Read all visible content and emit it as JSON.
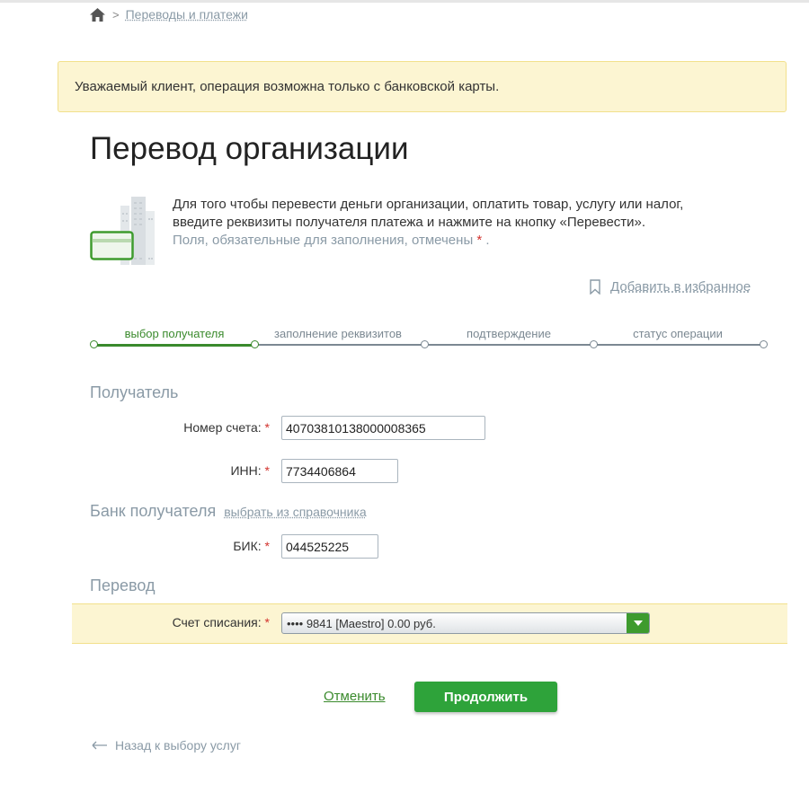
{
  "breadcrumb": {
    "home_icon": "home-icon",
    "separator": ">",
    "link": "Переводы и платежи"
  },
  "notice": {
    "text": "Уважаемый клиент, операция возможна только с банковской карты."
  },
  "page_title": "Перевод организации",
  "intro": {
    "line1": "Для того чтобы перевести деньги организации, оплатить товар, услугу или налог,",
    "line2": "введите реквизиты получателя платежа и нажмите на кнопку «Перевести».",
    "required_note": "Поля, обязательные для заполнения, отмечены",
    "required_star": "*",
    "required_end": "."
  },
  "favorite": {
    "icon": "bookmark-icon",
    "label": "Добавить в избранное"
  },
  "steps": [
    {
      "label": "выбор получателя",
      "active": true
    },
    {
      "label": "заполнение реквизитов",
      "active": false
    },
    {
      "label": "подтверждение",
      "active": false
    },
    {
      "label": "статус операции",
      "active": false
    }
  ],
  "recipient": {
    "section": "Получатель",
    "account_label": "Номер счета:",
    "account_value": "40703810138000008365",
    "inn_label": "ИНН:",
    "inn_value": "7734406864",
    "required_star": "*"
  },
  "bank": {
    "section": "Банк получателя",
    "dict_link": "выбрать из справочника",
    "bik_label": "БИК:",
    "bik_value": "044525225"
  },
  "transfer": {
    "section": "Перевод",
    "debit_label": "Счет списания:",
    "debit_value": "•••• 9841 [Maestro] 0.00 руб."
  },
  "actions": {
    "cancel": "Отменить",
    "continue": "Продолжить",
    "back": "Назад к выбору услуг"
  },
  "colors": {
    "accent_green": "#2ea33a",
    "link_green": "#3a8a2c",
    "notice_bg": "#fcf5d2",
    "required_red": "#d2322d",
    "muted_text": "#8a9aa6"
  }
}
